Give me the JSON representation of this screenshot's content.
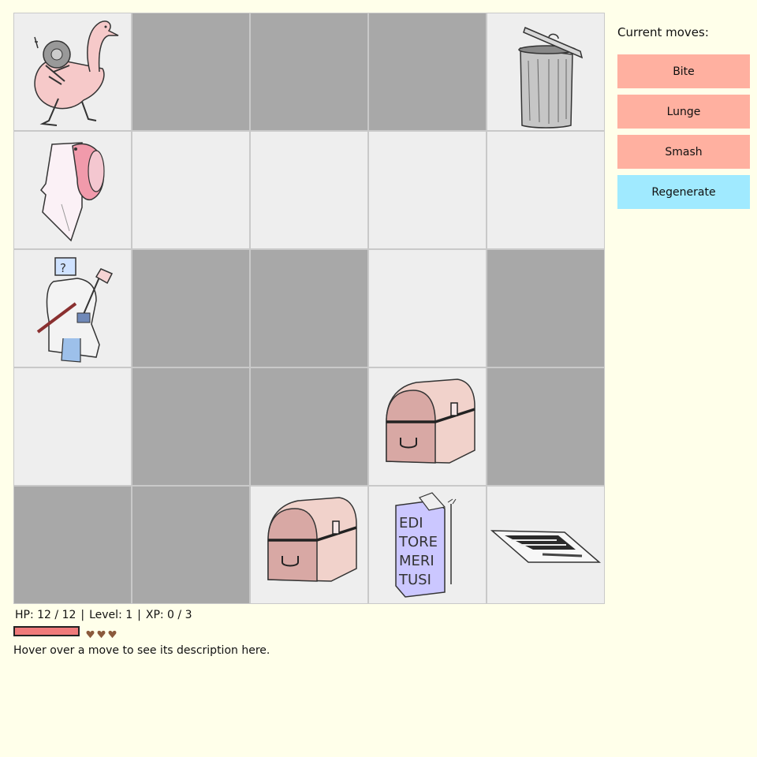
{
  "board": {
    "rows": 5,
    "cols": 5,
    "cells": [
      [
        "floor",
        "wall",
        "wall",
        "wall",
        "floor"
      ],
      [
        "floor",
        "floor",
        "floor",
        "floor",
        "floor"
      ],
      [
        "floor",
        "wall",
        "wall",
        "floor",
        "wall"
      ],
      [
        "floor",
        "wall",
        "wall",
        "floor",
        "wall"
      ],
      [
        "wall",
        "wall",
        "floor",
        "floor",
        "floor"
      ]
    ],
    "sprites": [
      {
        "name": "mechanical-swan",
        "row": 0,
        "col": 0,
        "kind": "swan"
      },
      {
        "name": "trash-can",
        "row": 0,
        "col": 4,
        "kind": "trash"
      },
      {
        "name": "torn-paper-backpack",
        "row": 1,
        "col": 0,
        "kind": "paper"
      },
      {
        "name": "question-mark-scientist",
        "row": 2,
        "col": 0,
        "kind": "scientist"
      },
      {
        "name": "treasure-chest",
        "row": 3,
        "col": 3,
        "kind": "chest"
      },
      {
        "name": "treasure-chest",
        "row": 4,
        "col": 2,
        "kind": "chest"
      },
      {
        "name": "editore-box",
        "row": 4,
        "col": 3,
        "kind": "box"
      },
      {
        "name": "floor-pit",
        "row": 4,
        "col": 4,
        "kind": "pit"
      }
    ]
  },
  "side_panel": {
    "title": "Current moves:",
    "moves": [
      {
        "label": "Bite",
        "color": "#ffb0a0"
      },
      {
        "label": "Lunge",
        "color": "#ffb0a0"
      },
      {
        "label": "Smash",
        "color": "#ffb0a0"
      },
      {
        "label": "Regenerate",
        "color": "#a0eaff"
      }
    ]
  },
  "status": {
    "hp_label": "HP: 12 / 12",
    "level_label": "Level: 1",
    "xp_label": "XP: 0 / 3",
    "separator": "|",
    "hp_current": 12,
    "hp_max": 12,
    "hp_color": "#ef7a7a",
    "hearts": 3,
    "heart_color": "#8b5a3c"
  },
  "description": "Hover over a move to see its description here."
}
